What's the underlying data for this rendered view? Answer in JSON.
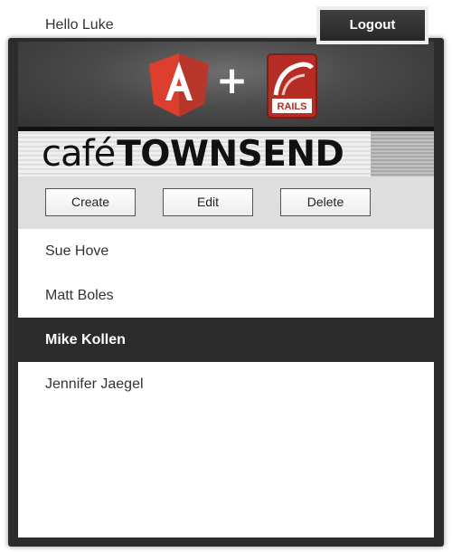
{
  "header": {
    "greeting": "Hello Luke",
    "logout_label": "Logout"
  },
  "logos": {
    "left": "angular-logo",
    "separator": "+",
    "right": "rails-logo",
    "rails_text": "RAILS"
  },
  "banner": {
    "brand_light": "café",
    "brand_bold": "TOWNSEND"
  },
  "toolbar": {
    "create_label": "Create",
    "edit_label": "Edit",
    "delete_label": "Delete"
  },
  "employees": [
    {
      "name": "Sue Hove",
      "selected": false
    },
    {
      "name": "Matt Boles",
      "selected": false
    },
    {
      "name": "Mike Kollen",
      "selected": true
    },
    {
      "name": "Jennifer Jaegel",
      "selected": false
    }
  ],
  "colors": {
    "panel": "#2c2c2c",
    "toolbar": "#dedede",
    "selected_row": "#2c2c2c",
    "angular_red": "#dd3f2f",
    "rails_red": "#b52d25"
  }
}
